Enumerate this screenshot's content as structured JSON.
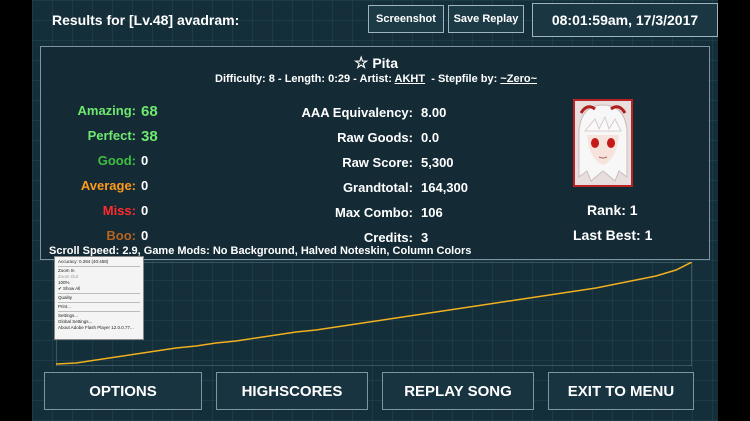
{
  "header": {
    "title": "Results for [Lv.48] avadram:",
    "screenshot_label": "Screenshot",
    "save_replay_label": "Save Replay",
    "datetime": "08:01:59am, 17/3/2017"
  },
  "song": {
    "name": "Pita",
    "difficulty_label": "Difficulty:",
    "difficulty": "8",
    "length_label": "Length:",
    "length": "0:29",
    "artist_label": "Artist:",
    "artist": "AKHT",
    "stepfile_label": "Stepfile by:",
    "stepfile_by": "~Zero~"
  },
  "judgements": [
    {
      "label": "Amazing:",
      "value": "68",
      "color": "#6fe86f"
    },
    {
      "label": "Perfect:",
      "value": "38",
      "color": "#6fe86f"
    },
    {
      "label": "Good:",
      "value": "0",
      "color": "#3fbf3f"
    },
    {
      "label": "Average:",
      "value": "0",
      "color": "#ff9a1a"
    },
    {
      "label": "Miss:",
      "value": "0",
      "color": "#ff2a2a"
    },
    {
      "label": "Boo:",
      "value": "0",
      "color": "#b8641e"
    }
  ],
  "stats": [
    {
      "label": "AAA Equivalency:",
      "value": "8.00"
    },
    {
      "label": "Raw Goods:",
      "value": "0.0"
    },
    {
      "label": "Raw Score:",
      "value": "5,300"
    },
    {
      "label": "Grandtotal:",
      "value": "164,300"
    },
    {
      "label": "Max Combo:",
      "value": "106"
    },
    {
      "label": "Credits:",
      "value": "3"
    }
  ],
  "rank": "Rank: 1",
  "last_best": "Last Best: 1",
  "mods": "Scroll Speed: 2.9, Game Mods: No Background, Halved Noteskin, Column Colors",
  "context_menu": {
    "items": [
      "Accuracy: 0.284 (40:458)",
      "Zoom In",
      "Zoom Out",
      "100%",
      "✔ Show All",
      "Quality",
      "Print...",
      "Settings...",
      "Global Settings...",
      "About Adobe Flash Player 12.0.0.77..."
    ]
  },
  "buttons": {
    "options": "OPTIONS",
    "highscores": "HIGHSCORES",
    "replay": "REPLAY SONG",
    "exit": "EXIT TO MENU"
  },
  "colors": {
    "background": "#142e3a",
    "graph_line": "#f0b020",
    "panel_border": "#7d95a2"
  }
}
